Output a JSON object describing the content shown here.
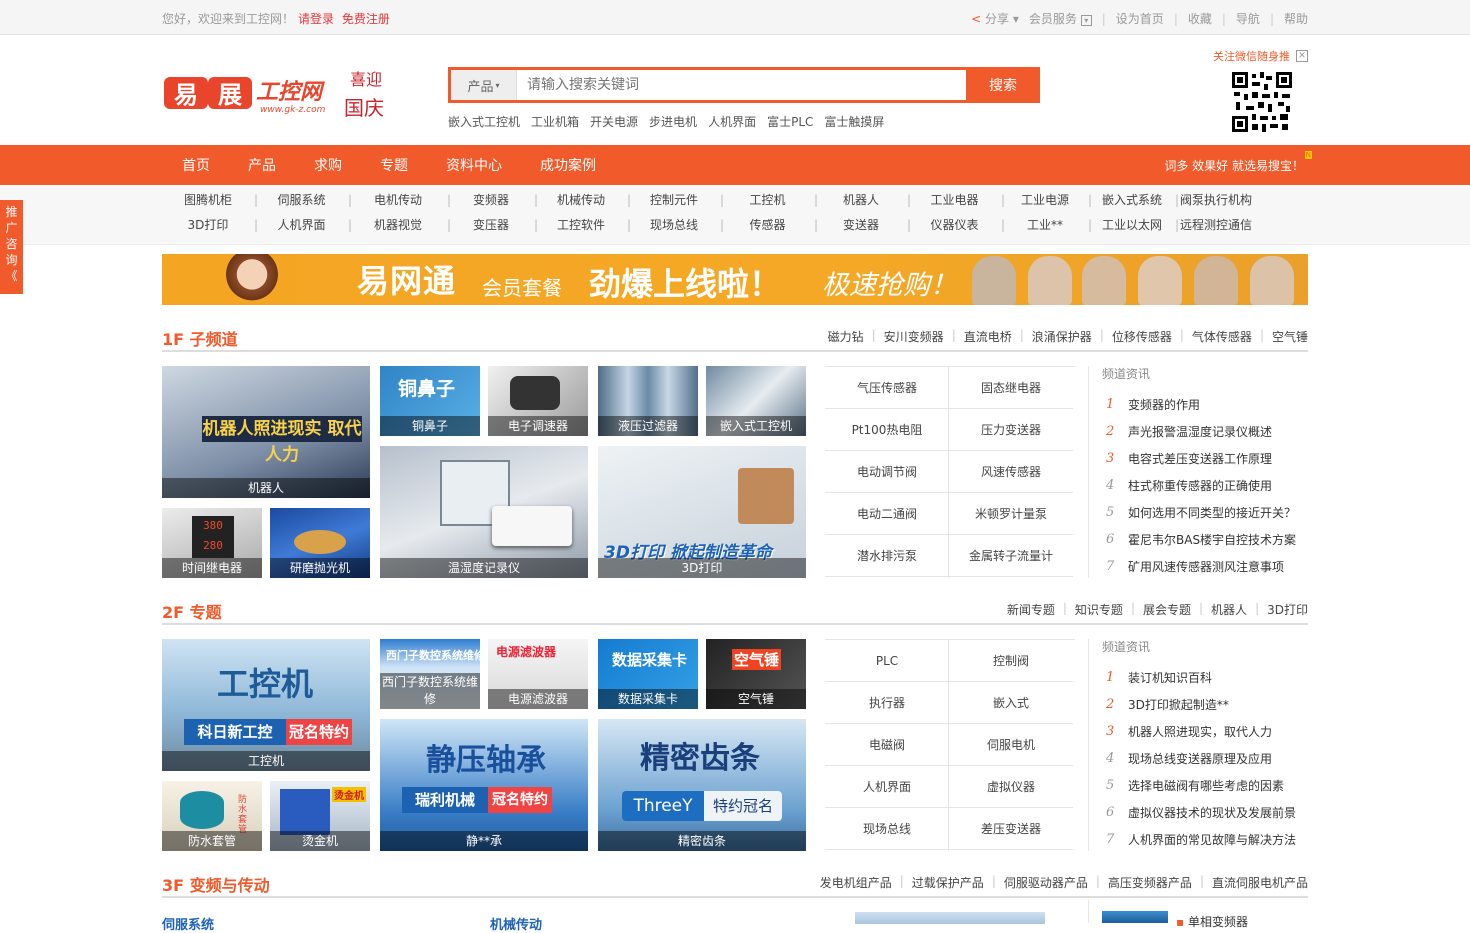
{
  "topbar": {
    "greeting": "您好，欢迎来到工控网！",
    "login": "请登录",
    "register": "免费注册",
    "right": [
      "分享",
      "会员服务",
      "设为首页",
      "收藏",
      "导航",
      "帮助"
    ]
  },
  "logo": {
    "name": "易展工控网",
    "url_text": "www.gk-z.com",
    "festive": "喜迎国庆"
  },
  "search": {
    "category": "产品",
    "placeholder": "请输入搜索关键词",
    "button": "搜索"
  },
  "hotwords": [
    "嵌入式工控机",
    "工业机箱",
    "开关电源",
    "步进电机",
    "人机界面",
    "富士PLC",
    "富士触摸屏"
  ],
  "qr_tip": "关注微信随身推",
  "nav": {
    "items": [
      "首页",
      "产品",
      "求购",
      "专题",
      "资料中心",
      "成功案例"
    ],
    "slogan": "词多 效果好 就选易搜宝！",
    "badge": "N"
  },
  "categories": {
    "row1": [
      "图腾机柜",
      "伺服系统",
      "电机传动",
      "变频器",
      "机械传动",
      "控制元件",
      "工控机",
      "机器人",
      "工业电器",
      "工业电源",
      "嵌入式系统",
      "阀泵执行机构"
    ],
    "row2": [
      "3D打印",
      "人机界面",
      "机器视觉",
      "变压器",
      "工控软件",
      "现场总线",
      "传感器",
      "变送器",
      "仪器仪表",
      "工业**",
      "工业以太网",
      "远程测控通信"
    ]
  },
  "side_tab": [
    "推",
    "广",
    "咨",
    "询",
    "《"
  ],
  "banner": {
    "brand": "易网通",
    "pkg": "会员套餐",
    "headline": "劲爆上线啦！",
    "cta": "极速抢购！"
  },
  "floor1": {
    "title": "1F 子频道",
    "links": [
      "磁力钻",
      "安川变频器",
      "直流电桥",
      "浪涌保护器",
      "位移传感器",
      "气体传感器",
      "空气锤"
    ],
    "pics": {
      "robot": "机器人",
      "robot_banner": "机器人照进现实 取代人力",
      "copper": "铜鼻子",
      "copper_banner": "铜鼻子",
      "motor": "电子调速器",
      "filter": "液压过滤器",
      "ipc": "嵌入式工控机",
      "timer": "时间继电器",
      "polish": "研磨抛光机",
      "recorder": "温湿度记录仪",
      "print3d": "3D打印",
      "print3d_banner": "3D打印 掀起制造革命"
    },
    "grid": [
      "气压传感器",
      "固态继电器",
      "Pt100热电阻",
      "压力变送器",
      "电动调节阀",
      "风速传感器",
      "电动二通阀",
      "米顿罗计量泵",
      "潜水排污泵",
      "金属转子流量计"
    ],
    "news_title": "频道资讯",
    "news": [
      "变频器的作用",
      "声光报警温湿度记录仪概述",
      "电容式差压变送器工作原理",
      "柱式称重传感器的正确使用",
      "如何选用不同类型的接近开关？",
      "霍尼韦尔BAS楼宇自控技术方案",
      "矿用风速传感器测风注意事项"
    ]
  },
  "floor2": {
    "title": "2F 专题",
    "links": [
      "新闻专题",
      "知识专题",
      "展会专题",
      "机器人",
      "3D打印"
    ],
    "pics": {
      "ipc": "工控机",
      "ipc_big": "工控机",
      "ipc_sponsor": "科日新工控",
      "ipc_tag": "冠名特约",
      "siemens": "西门子数控系统维修",
      "siemens_banner": "西门子数控系统维修",
      "emi": "电源滤波器",
      "emi_banner": "电源滤波器",
      "daq": "数据采集卡",
      "daq_banner": "数据采集卡",
      "hammer": "空气锤",
      "hammer_banner": "空气锤",
      "pipe": "防水套管",
      "pipe_tag": "防水套管",
      "hot": "烫金机",
      "hot_tag": "烫金机",
      "bearing": "静**承",
      "bearing_big": "静压轴承",
      "bearing_sponsor": "瑞利机械",
      "bearing_tag": "冠名特约",
      "rack": "精密齿条",
      "rack_big": "精密齿条",
      "rack_sponsor": "ThreeY",
      "rack_tag": "特约冠名"
    },
    "grid": [
      "PLC",
      "控制阀",
      "执行器",
      "嵌入式",
      "电磁阀",
      "伺服电机",
      "人机界面",
      "虚拟仪器",
      "现场总线",
      "差压变送器"
    ],
    "news_title": "频道资讯",
    "news": [
      "装订机知识百科",
      "3D打印掀起制造**",
      "机器人照进现实，取代人力",
      "现场总线变送器原理及应用",
      "选择电磁阀有哪些考虑的因素",
      "虚拟仪器技术的现状及发展前景",
      "人机界面的常见故障与解决方法"
    ]
  },
  "floor3": {
    "title": "3F 变频与传动",
    "links": [
      "发电机组产品",
      "过载保护产品",
      "伺服驱动器产品",
      "高压变频器产品",
      "直流伺服电机产品"
    ],
    "sub1": "伺服系统",
    "sub2": "机械传动",
    "news_first": "单相变频器"
  },
  "colors": {
    "accent": "#f15a2b",
    "nav": "#f15a2b",
    "banner": "#f4a623"
  }
}
